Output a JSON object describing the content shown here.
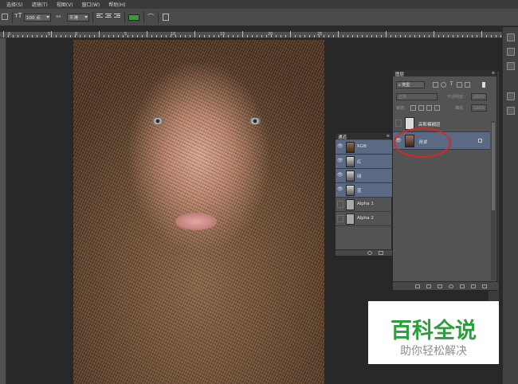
{
  "menu": [
    "选择(S)",
    "滤镜(T)",
    "视图(V)",
    "窗口(W)",
    "帮助(H)"
  ],
  "options": {
    "font_size": "100 点",
    "antialias_label": "aa",
    "antialias": "平滑",
    "text_color": "#3d9a3a"
  },
  "ruler_h": [
    "0",
    "5",
    "0",
    "5",
    "10",
    "15",
    "20",
    "25"
  ],
  "channels_panel": {
    "tab": "通道",
    "rows": [
      {
        "name": "RGB",
        "visible": true,
        "selected": true
      },
      {
        "name": "红",
        "visible": true,
        "selected": true
      },
      {
        "name": "绿",
        "visible": true,
        "selected": true
      },
      {
        "name": "蓝",
        "visible": true,
        "selected": true
      },
      {
        "name": "Alpha 1",
        "visible": false,
        "selected": false
      },
      {
        "name": "Alpha 2",
        "visible": false,
        "selected": false
      }
    ]
  },
  "layers_panel": {
    "tab": "图层",
    "filter_kind": "类型",
    "blend_mode": "正常",
    "opacity_label": "不透明度:",
    "opacity": "100%",
    "lock_label": "锁定:",
    "fill_label": "填充:",
    "fill": "100%",
    "layers": [
      {
        "name": "高斯模糊层",
        "visible": false,
        "selected": false
      },
      {
        "name": "背景",
        "visible": true,
        "selected": true,
        "locked": true
      }
    ]
  },
  "highlight_color": "#d8262b",
  "watermark": {
    "title": "百科全说",
    "subtitle": "助你轻松解决",
    "color": "#2c9e3b"
  }
}
